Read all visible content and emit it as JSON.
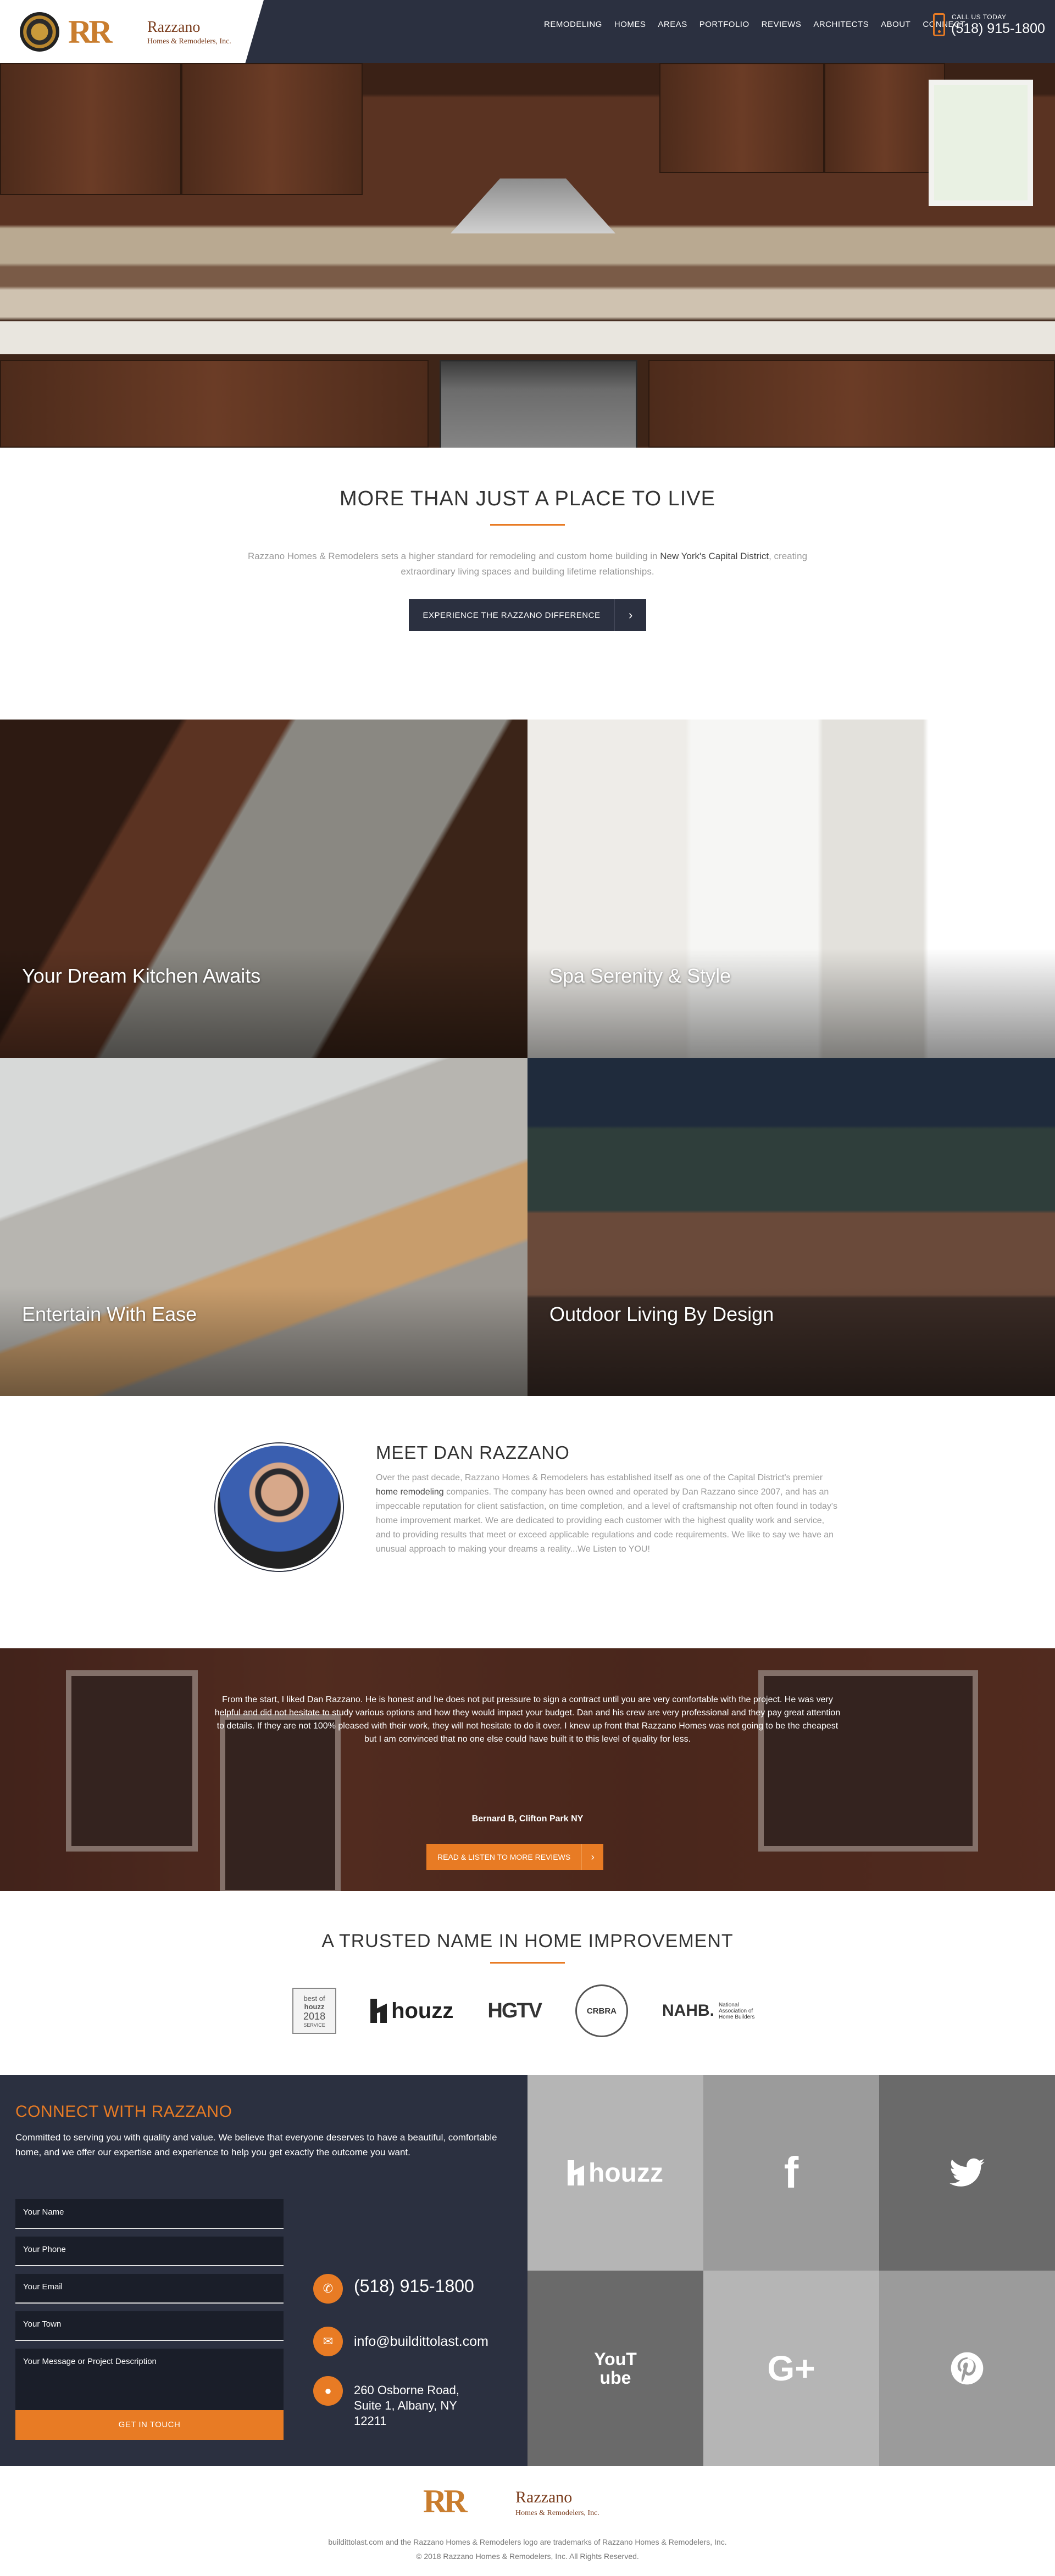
{
  "header": {
    "brand_mark": "RR",
    "brand_name": "Razzano",
    "brand_sub": "Homes & Remodelers, Inc.",
    "nav": [
      "REMODELING",
      "HOMES",
      "AREAS",
      "PORTFOLIO",
      "REVIEWS",
      "ARCHITECTS",
      "ABOUT",
      "CONNECT"
    ],
    "call_label": "CALL US TODAY",
    "call_number": "(518) 915-1800"
  },
  "intro": {
    "title": "MORE THAN JUST A PLACE TO LIVE",
    "text_before": "Razzano Homes & Remodelers sets a higher standard for remodeling and custom home building in ",
    "text_bold": "New York's Capital District",
    "text_after": ", creating extraordinary living spaces and building lifetime relationships.",
    "button": "EXPERIENCE THE RAZZANO DIFFERENCE",
    "button_arrow": "›"
  },
  "tiles": [
    "Your Dream Kitchen Awaits",
    "Spa Serenity & Style",
    "Entertain With Ease",
    "Outdoor Living By Design"
  ],
  "meet": {
    "title": "MEET DAN RAZZANO",
    "text_before": "Over the past decade, Razzano Homes & Remodelers has established itself as one of the Capital District's premier ",
    "text_bold": "home remodeling",
    "text_after": " companies. The company has been owned and operated by Dan Razzano since 2007, and has an impeccable reputation for client satisfaction, on time completion, and a level of craftsmanship not often found in today's home improvement market. We are dedicated to providing each customer with the highest quality work and service, and to providing results that meet or exceed applicable regulations and code requirements. We like to say we have an unusual approach to making your dreams a reality...We Listen to YOU!"
  },
  "review": {
    "quote": "From the start, I liked Dan Razzano. He is honest and he does not put pressure to sign a contract until you are very comfortable with the project. He was very helpful and did not hesitate to study various options and how they would impact your budget. Dan and his crew are very professional and they pay great attention to details. If they are not 100% pleased with their work, they will not hesitate to do it over. I knew up front that Razzano Homes was not going to be the cheapest but I am convinced that no one else could have built it to this level of quality for less.",
    "author": "Bernard B, Clifton Park NY",
    "button": "READ & LISTEN TO MORE REVIEWS",
    "button_arrow": "›"
  },
  "trusted": {
    "title": "A TRUSTED NAME IN HOME IMPROVEMENT",
    "badge_top": "best of",
    "badge_name": "houzz",
    "badge_year": "2018",
    "badge_bottom": "SERVICE",
    "houzz": "houzz",
    "hgtv": "HGTV",
    "crbra": "CRBRA",
    "nahb": "NAHB.",
    "nahb_small": "National Association of Home Builders"
  },
  "connect": {
    "title": "CONNECT WITH RAZZANO",
    "intro": "Committed to serving you with quality and value. We believe that everyone deserves to have a beautiful, comfortable home, and we offer our expertise and experience to help you get exactly the outcome you want.",
    "fields": [
      "Your Name",
      "Your Phone",
      "Your Email",
      "Your Town",
      "Your Message or Project Description"
    ],
    "submit": "GET IN TOUCH",
    "phone": "(518) 915-1800",
    "email": "info@buildittolast.com",
    "address": [
      "260 Osborne Road,",
      "Suite 1, Albany, NY",
      "12211"
    ]
  },
  "social": [
    "houzz",
    "f",
    "twitter",
    "YouTube",
    "G+",
    "pinterest"
  ],
  "footer": {
    "brand_mark": "RR",
    "brand_name": "Razzano",
    "brand_sub": "Homes & Remodelers, Inc.",
    "trademark": "buildittolast.com and the Razzano Homes & Remodelers logo are trademarks of Razzano Homes & Remodelers, Inc.",
    "copyright": "© 2018 Razzano Homes & Remodelers, Inc. All Rights Reserved."
  },
  "colors": {
    "accent": "#e87b24",
    "navy": "#2b3040"
  }
}
